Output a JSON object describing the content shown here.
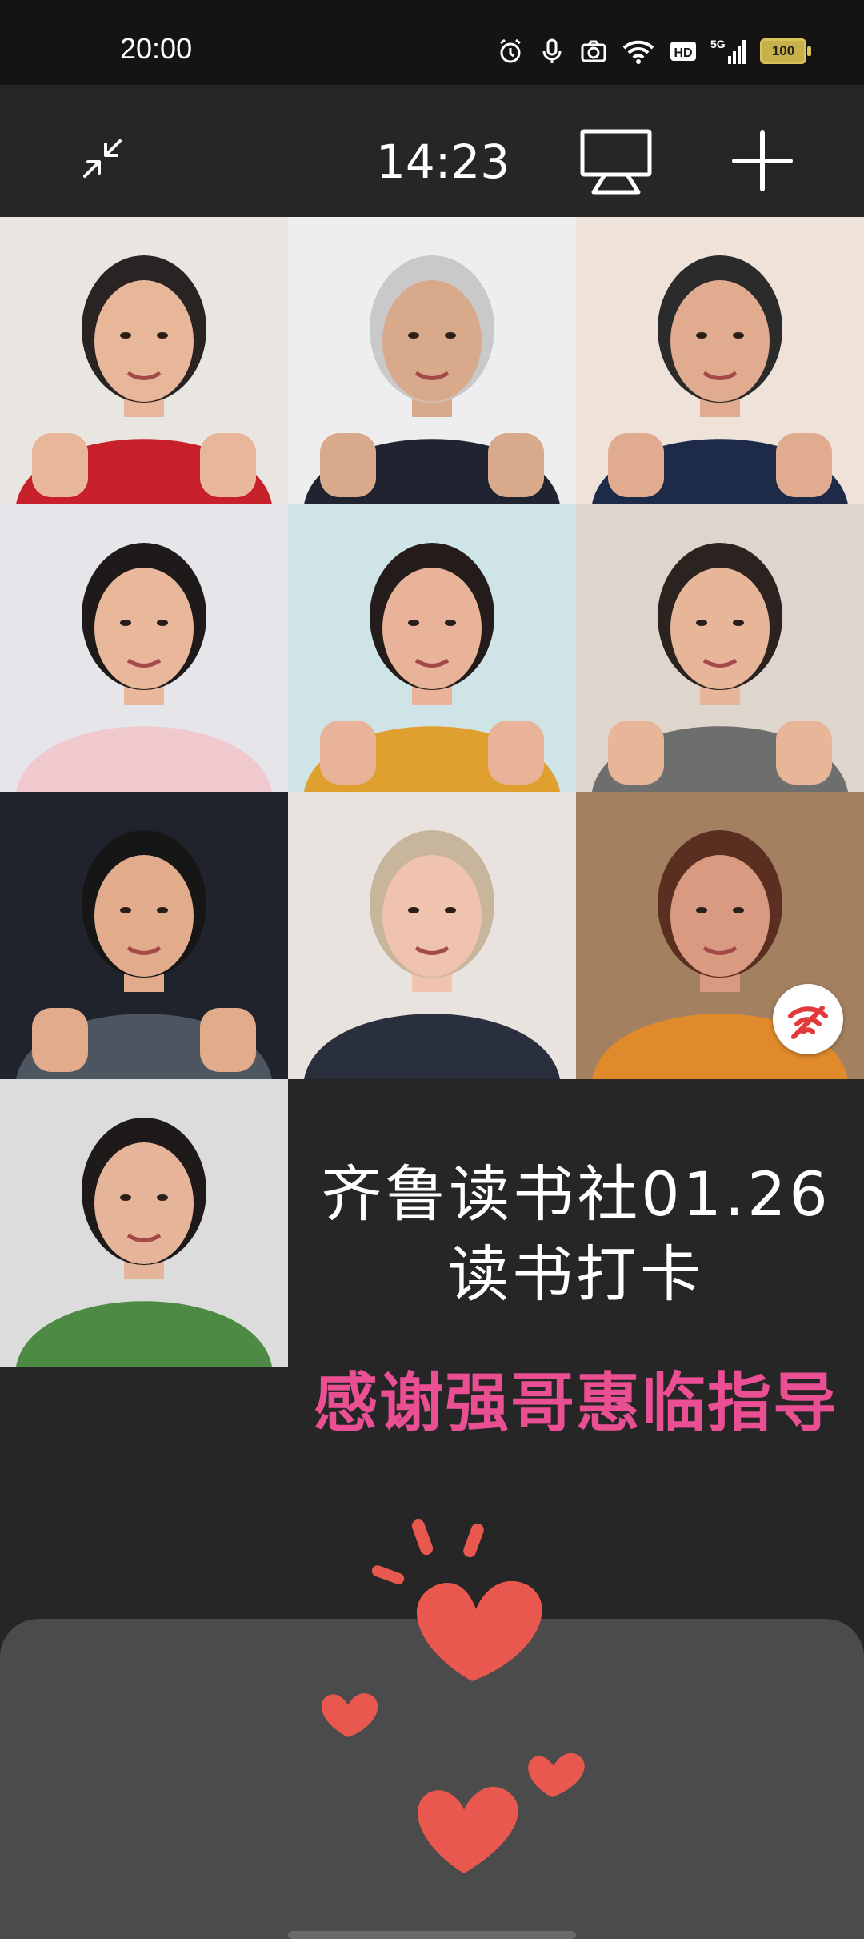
{
  "status_bar": {
    "time": "20:00",
    "icons": [
      "alarm-icon",
      "mic-icon",
      "camera-icon",
      "wifi-icon",
      "hd-icon",
      "signal-5g-icon"
    ],
    "battery": "100"
  },
  "toolbar": {
    "minimize_icon": "collapse-arrows-icon",
    "call_duration": "14:23",
    "present_icon": "screen-share-icon",
    "add_icon": "plus-icon"
  },
  "participants": [
    {
      "bg": "#e9e6e2",
      "shirt": "#c8202a",
      "hair": "#2a2323",
      "skin": "#e8b79a"
    },
    {
      "bg": "#eeeeee",
      "shirt": "#1f2430",
      "hair": "#c9c9c9",
      "skin": "#d9a98c"
    },
    {
      "bg": "#efe2d8",
      "shirt": "#1d2a48",
      "hair": "#2b2b2b",
      "skin": "#e0ab8e"
    },
    {
      "bg": "#e6e6ea",
      "shirt": "#f0c9cf",
      "hair": "#1e1a1a",
      "skin": "#e9b89b"
    },
    {
      "bg": "#cfe4e6",
      "shirt": "#e0a030",
      "hair": "#241c1a",
      "skin": "#e8b398"
    },
    {
      "bg": "#ded6cc",
      "shirt": "#6e6e6e",
      "hair": "#2b2320",
      "skin": "#e7b699"
    },
    {
      "bg": "#20232b",
      "shirt": "#4d5660",
      "hair": "#161616",
      "skin": "#e2ab8b"
    },
    {
      "bg": "#e8e3de",
      "shirt": "#2a2f3e",
      "hair": "#c8b69c",
      "skin": "#efc3ad"
    },
    {
      "bg": "#a38060",
      "shirt": "#e08a2c",
      "hair": "#5a2f22",
      "skin": "#d89a80"
    },
    {
      "bg": "#dcdcdc",
      "shirt": "#4d8a44",
      "hair": "#1e1a1a",
      "skin": "#e6b498"
    }
  ],
  "banner": {
    "line1": "齐鲁读书社01.26",
    "line2": "读书打卡",
    "thanks": "感谢强哥惠临指导"
  },
  "colors": {
    "background": "#262626",
    "thanks_text": "#ea4f93",
    "heart": "#e8584f",
    "sheet": "#4b4b4b"
  },
  "network_badge_icon": "weak-signal-icon"
}
